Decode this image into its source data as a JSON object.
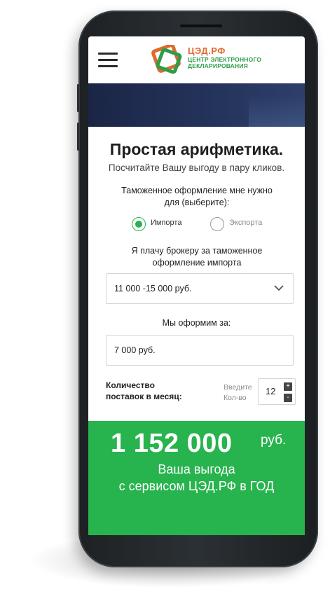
{
  "header": {
    "logo_line1": "ЦЭД.РФ",
    "logo_line2": "ЦЕНТР ЭЛЕКТРОННОГО",
    "logo_line3": "ДЕКЛАРИРОВАНИЯ"
  },
  "calculator": {
    "title": "Простая арифметика.",
    "subtitle": "Посчитайте Вашу выгоду в пару кликов.",
    "question_type_line1": "Таможенное оформление мне нужно",
    "question_type_line2": "для (выберите):",
    "options": [
      {
        "label": "Импорта",
        "selected": true
      },
      {
        "label": "Экспорта",
        "selected": false
      }
    ],
    "question_pay_line1": "Я плачу брокеру за таможенное",
    "question_pay_line2": "оформление импорта",
    "pay_select_value": "11 000 -15 000 руб.",
    "question_our_price": "Мы оформим за:",
    "our_price_value": "7 000 руб.",
    "qty_label_line1": "Количество",
    "qty_label_line2": "поставок в месяц:",
    "qty_hint_line1": "Введите",
    "qty_hint_line2": "Кол-во",
    "qty_value": "12",
    "qty_plus": "+",
    "qty_minus": "-"
  },
  "result": {
    "amount": "1 152 000",
    "currency": "руб.",
    "caption_line1": "Ваша выгода",
    "caption_line2": "с сервисом ЦЭД.РФ в ГОД"
  },
  "colors": {
    "accent_green": "#27b34d",
    "logo_orange": "#e06a2e",
    "hero_navy": "#1b2646"
  },
  "icons": {
    "menu": "hamburger-icon",
    "select_arrow": "chevron-down-icon"
  }
}
